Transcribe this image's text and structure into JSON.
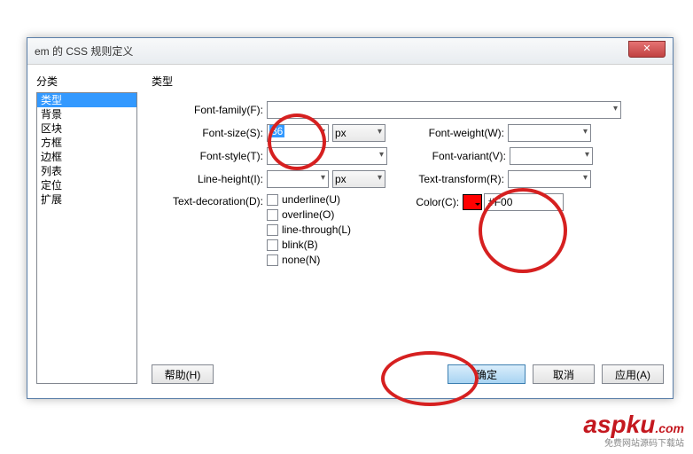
{
  "title": "em 的 CSS 规则定义",
  "sidebar": {
    "label": "分类",
    "items": [
      "类型",
      "背景",
      "区块",
      "方框",
      "边框",
      "列表",
      "定位",
      "扩展"
    ]
  },
  "main": {
    "label": "类型",
    "fields": {
      "fontFamily": {
        "label": "Font-family(F):",
        "value": ""
      },
      "fontSize": {
        "label": "Font-size(S):",
        "value": "36",
        "unit": "px"
      },
      "fontWeight": {
        "label": "Font-weight(W):",
        "value": ""
      },
      "fontStyle": {
        "label": "Font-style(T):",
        "value": ""
      },
      "fontVariant": {
        "label": "Font-variant(V):",
        "value": ""
      },
      "lineHeight": {
        "label": "Line-height(I):",
        "value": "",
        "unit": "px"
      },
      "textTransform": {
        "label": "Text-transform(R):",
        "value": ""
      },
      "textDecoration": {
        "label": "Text-decoration(D):",
        "opts": {
          "underline": "underline(U)",
          "overline": "overline(O)",
          "lineThrough": "line-through(L)",
          "blink": "blink(B)",
          "none": "none(N)"
        }
      },
      "color": {
        "label": "Color(C):",
        "value": "#F00"
      }
    }
  },
  "buttons": {
    "help": "帮助(H)",
    "ok": "确定",
    "cancel": "取消",
    "apply": "应用(A)"
  },
  "watermark": "aspku"
}
